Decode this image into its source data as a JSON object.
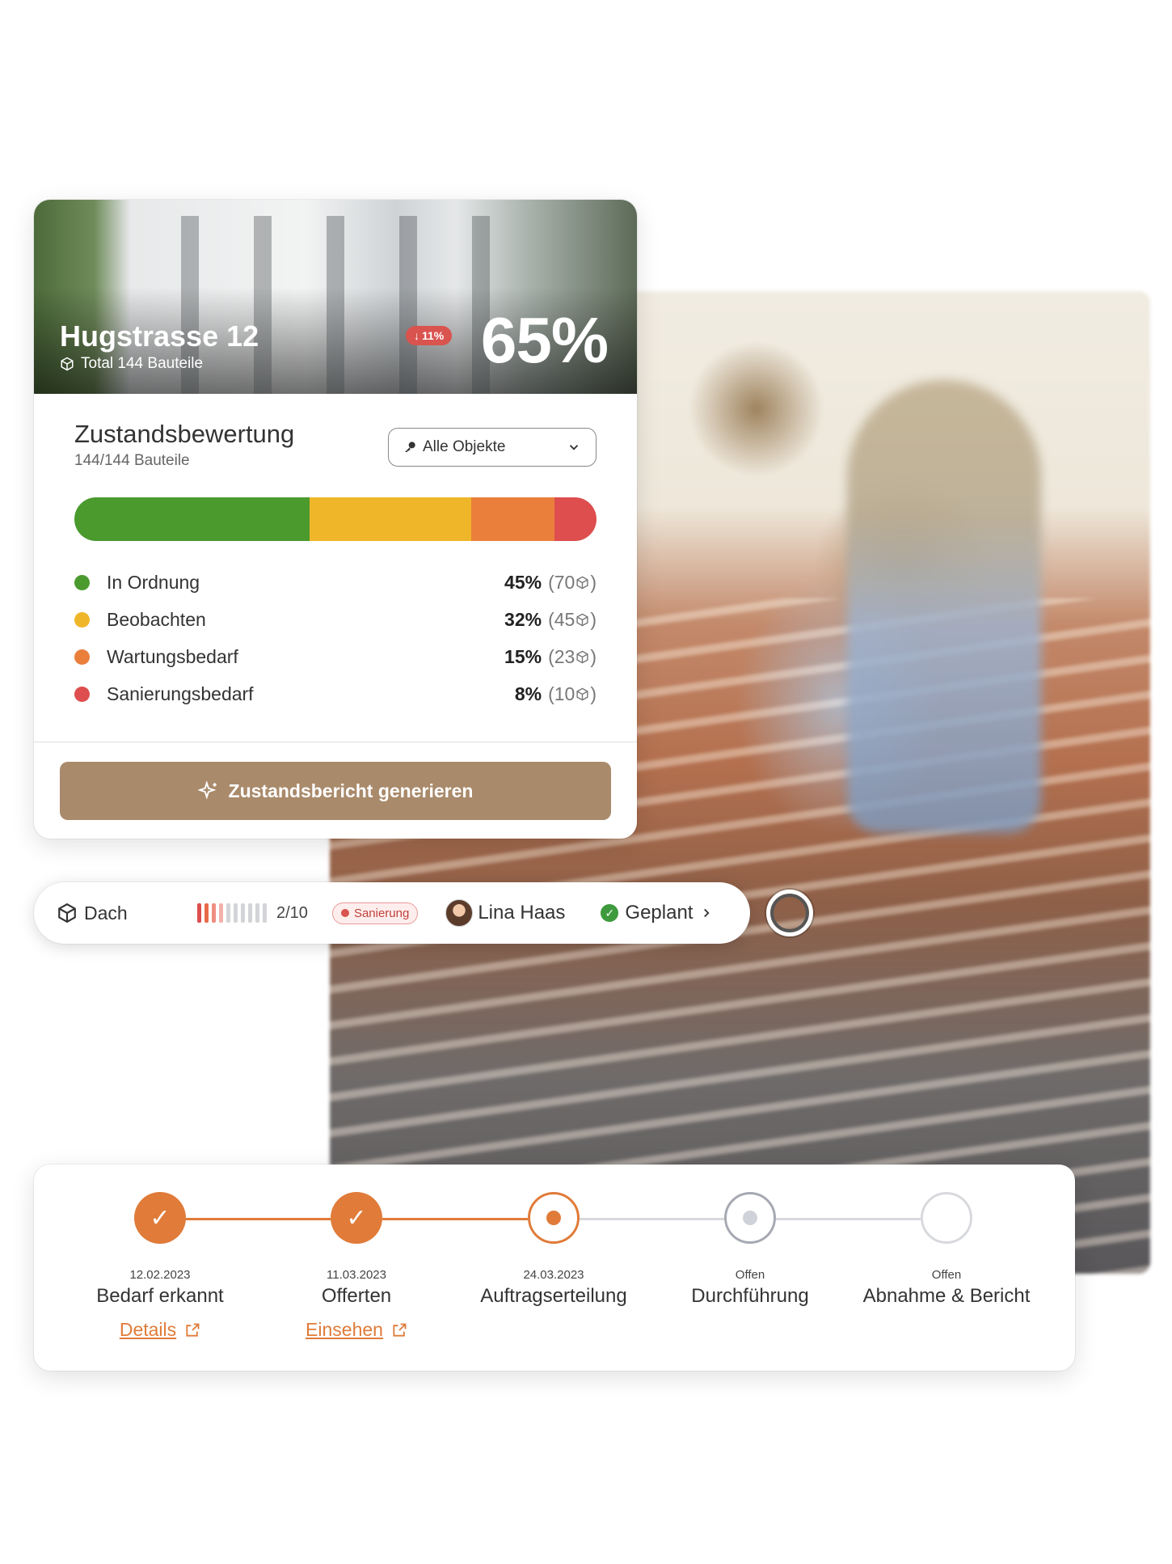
{
  "property": {
    "name": "Hugstrasse 12",
    "components_total": "Total 144 Bauteile",
    "change_badge": "11%",
    "score": "65%"
  },
  "assessment": {
    "title": "Zustandsbewertung",
    "subtitle": "144/144 Bauteile",
    "filter": {
      "selected": "Alle Objekte",
      "icon": "key-icon"
    },
    "categories": [
      {
        "label": "In Ordnung",
        "percent": "45%",
        "count": "(70",
        "color": "#4a9a2e",
        "share": 45
      },
      {
        "label": "Beobachten",
        "percent": "32%",
        "count": "(45",
        "color": "#f0b62a",
        "share": 31
      },
      {
        "label": "Wartungsbedarf",
        "percent": "15%",
        "count": "(23",
        "color": "#ea7f3c",
        "share": 16
      },
      {
        "label": "Sanierungsbedarf",
        "percent": "8%",
        "count": "(10",
        "color": "#de4e4e",
        "share": 8
      }
    ],
    "count_close": ")",
    "generate_button": "Zustandsbericht generieren"
  },
  "component_row": {
    "name": "Dach",
    "score": "2/10",
    "score_value": 2,
    "score_max": 10,
    "tag": "Sanierung",
    "assignee": "Lina Haas",
    "status": "Geplant"
  },
  "process": {
    "steps": [
      {
        "date": "12.02.2023",
        "label": "Bedarf erkannt",
        "link": "Details",
        "state": "done"
      },
      {
        "date": "11.03.2023",
        "label": "Offerten",
        "link": "Einsehen",
        "state": "done"
      },
      {
        "date": "24.03.2023",
        "label": "Auftragserteilung",
        "link": "",
        "state": "current"
      },
      {
        "date": "Offen",
        "label": "Durchführung",
        "link": "",
        "state": "next"
      },
      {
        "date": "Offen",
        "label": "Abnahme & Bericht",
        "link": "",
        "state": "open"
      }
    ]
  },
  "colors": {
    "accent": "#e07b39",
    "button": "#a98a6b",
    "danger": "#d9534f",
    "success": "#3d9a3d"
  }
}
